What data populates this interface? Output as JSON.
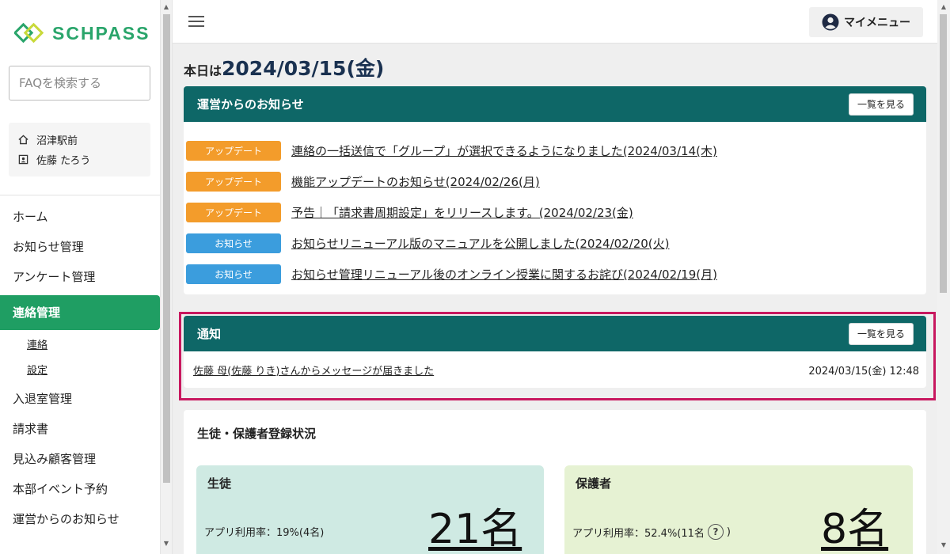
{
  "brand": {
    "name": "SCHPASS",
    "color": "#2aa56b"
  },
  "search": {
    "placeholder": "FAQを検索する"
  },
  "user": {
    "school": "沼津駅前",
    "name": "佐藤 たろう"
  },
  "sidebar": {
    "items": [
      {
        "label": "ホーム"
      },
      {
        "label": "お知らせ管理"
      },
      {
        "label": "アンケート管理"
      },
      {
        "label": "連絡管理",
        "active": true
      },
      {
        "label": "入退室管理"
      },
      {
        "label": "請求書"
      },
      {
        "label": "見込み顧客管理"
      },
      {
        "label": "本部イベント予約"
      },
      {
        "label": "運営からのお知らせ"
      }
    ],
    "subitems": [
      {
        "label": "連絡"
      },
      {
        "label": "設定"
      }
    ]
  },
  "header": {
    "mymenu_label": "マイメニュー"
  },
  "today": {
    "label": "本日は",
    "date": "2024/03/15(金)"
  },
  "news": {
    "title": "運営からのお知らせ",
    "list_button": "一覧を見る",
    "items": [
      {
        "tag": "アップデート",
        "tag_type": "update",
        "text": "連絡の一括送信で「グループ」が選択できるようになりました(2024/03/14(木)"
      },
      {
        "tag": "アップデート",
        "tag_type": "update",
        "text": "機能アップデートのお知らせ(2024/02/26(月)"
      },
      {
        "tag": "アップデート",
        "tag_type": "update",
        "text": "予告｜「請求書周期設定」をリリースします。(2024/02/23(金)"
      },
      {
        "tag": "お知らせ",
        "tag_type": "info",
        "text": "お知らせリニューアル版のマニュアルを公開しました(2024/02/20(火)"
      },
      {
        "tag": "お知らせ",
        "tag_type": "info",
        "text": "お知らせ管理リニューアル後のオンライン授業に関するお詫び(2024/02/19(月)"
      }
    ]
  },
  "notifications": {
    "title": "通知",
    "list_button": "一覧を見る",
    "items": [
      {
        "text": "佐藤 母(佐藤 りき)さんからメッセージが届きました",
        "time": "2024/03/15(金) 12:48"
      }
    ]
  },
  "registration": {
    "title": "生徒・保護者登録状況",
    "student": {
      "label": "生徒",
      "rate": "アプリ利用率：19%(4名)",
      "count": "21名"
    },
    "parent": {
      "label": "保護者",
      "rate_prefix": "アプリ利用率：52.4%(11名",
      "rate_suffix": ")",
      "count": "8名"
    }
  },
  "colors": {
    "header_teal": "#0e6767",
    "active_green": "#1f9e63",
    "update_orange": "#f39c2b",
    "info_blue": "#3b9ddd",
    "highlight": "#c8185f"
  }
}
